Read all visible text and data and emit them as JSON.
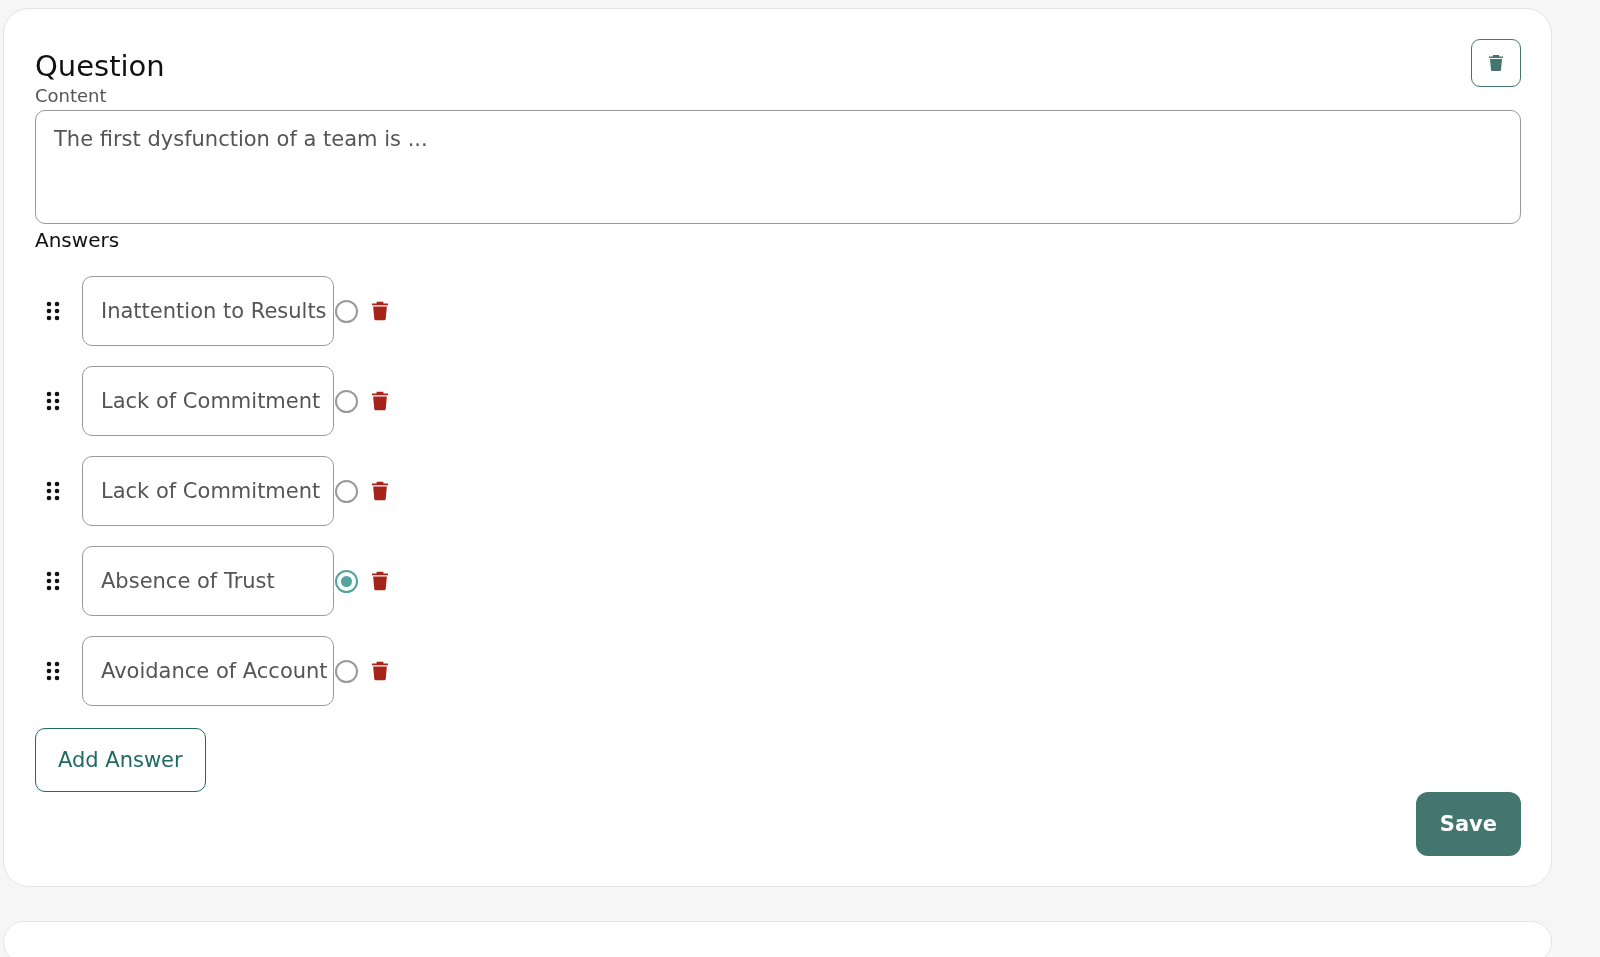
{
  "question": {
    "title": "Question",
    "content_label": "Content",
    "content": "The first dysfunction of a team is ...",
    "answers_label": "Answers",
    "answers": [
      {
        "text": "Inattention to Results",
        "selected": false
      },
      {
        "text": "Lack of Commitment",
        "selected": false
      },
      {
        "text": "Lack of Commitment",
        "selected": false
      },
      {
        "text": "Absence of Trust",
        "selected": true
      },
      {
        "text": "Avoidance of Account",
        "selected": false
      }
    ],
    "add_button": "Add Answer",
    "save_button": "Save"
  }
}
